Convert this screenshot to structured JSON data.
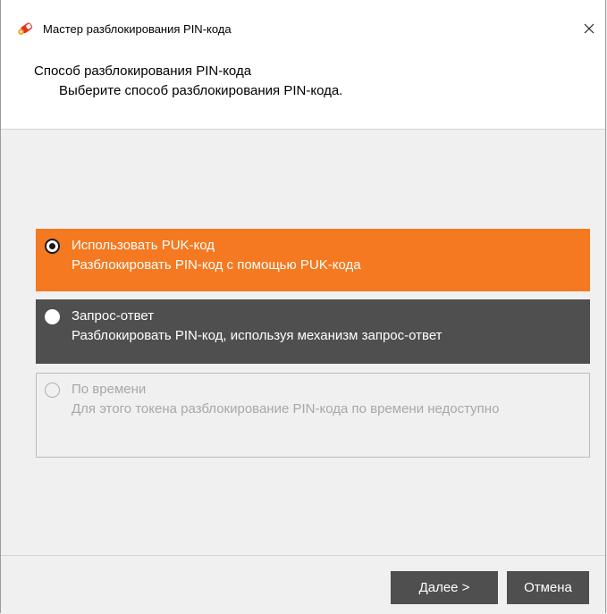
{
  "window": {
    "title": "Мастер разблокирования PIN-кода",
    "close_icon": "close-icon"
  },
  "header": {
    "title": "Способ разблокирования PIN-кода",
    "subtitle": "Выберите способ разблокирования PIN-кода."
  },
  "options": [
    {
      "title": "Использовать PUK-код",
      "description": "Разблокировать PIN-код с помощью PUK-кода",
      "selected": true,
      "enabled": true
    },
    {
      "title": "Запрос-ответ",
      "description": "Разблокировать PIN-код, используя механизм запрос-ответ",
      "selected": false,
      "enabled": true
    },
    {
      "title": "По времени",
      "description": "Для этого токена разблокирование PIN-кода по времени недоступно",
      "selected": false,
      "enabled": false
    }
  ],
  "buttons": {
    "next_label": "Далее >",
    "cancel_label": "Отмена"
  },
  "colors": {
    "accent_orange": "#f47920",
    "dark_gray": "#4f4f4f",
    "disabled_text": "#a8a8a8"
  }
}
